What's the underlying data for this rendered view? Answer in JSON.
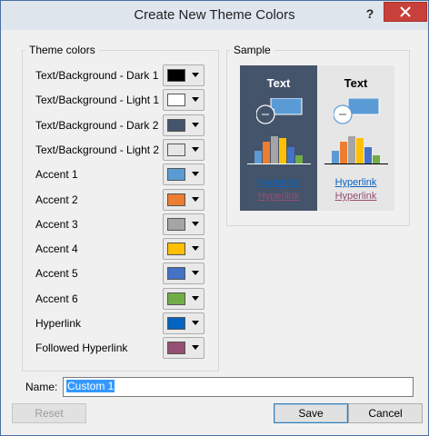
{
  "window": {
    "title": "Create New Theme Colors",
    "help_label": "?"
  },
  "theme_colors": {
    "group_label": "Theme colors",
    "rows": [
      {
        "label": "Text/Background - Dark 1",
        "color": "#000000"
      },
      {
        "label": "Text/Background - Light 1",
        "color": "#ffffff"
      },
      {
        "label": "Text/Background - Dark 2",
        "color": "#44546a"
      },
      {
        "label": "Text/Background - Light 2",
        "color": "#e7e6e6"
      },
      {
        "label": "Accent 1",
        "color": "#5b9bd5"
      },
      {
        "label": "Accent 2",
        "color": "#ed7d31"
      },
      {
        "label": "Accent 3",
        "color": "#a5a5a5"
      },
      {
        "label": "Accent 4",
        "color": "#ffc000"
      },
      {
        "label": "Accent 5",
        "color": "#4472c4"
      },
      {
        "label": "Accent 6",
        "color": "#70ad47"
      },
      {
        "label": "Hyperlink",
        "color": "#0563c1"
      },
      {
        "label": "Followed Hyperlink",
        "color": "#954f72"
      }
    ]
  },
  "sample": {
    "group_label": "Sample",
    "text_label": "Text",
    "hyperlink_label": "Hyperlink",
    "followed_hyperlink_label": "Hyperlink",
    "dark_bg": "#44546a",
    "light_bg": "#e7e6e6"
  },
  "name_field": {
    "label": "Name:",
    "value": "Custom 1"
  },
  "buttons": {
    "reset": "Reset",
    "save": "Save",
    "cancel": "Cancel"
  }
}
